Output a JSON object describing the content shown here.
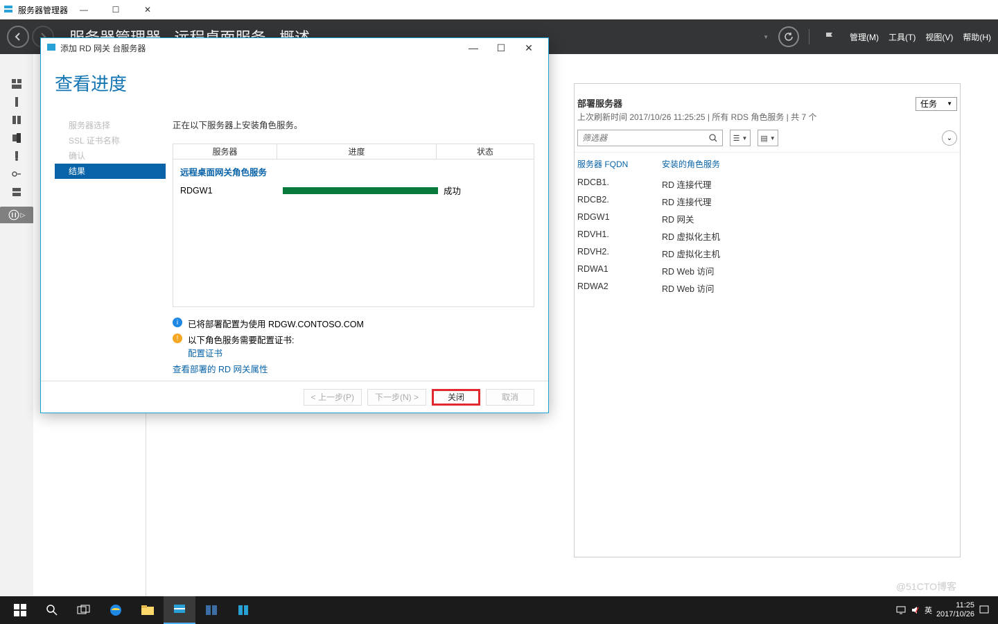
{
  "app": {
    "title": "服务器管理器",
    "breadcrumb": "服务器管理器 · 远程桌面服务 · 概述",
    "menu": {
      "manage": "管理(M)",
      "tools": "工具(T)",
      "view": "视图(V)",
      "help": "帮助(H)"
    }
  },
  "deploy": {
    "title": "部署服务器",
    "sub": "上次刷新时间 2017/10/26 11:25:25 | 所有 RDS 角色服务  | 共 7 个",
    "task_btn": "任务",
    "filter_placeholder": "筛选器",
    "headers": {
      "fqdn": "服务器 FQDN",
      "role": "安装的角色服务"
    },
    "rows": [
      {
        "fqdn": "RDCB1.",
        "role": "RD 连接代理"
      },
      {
        "fqdn": "RDCB2.",
        "role": "RD 连接代理"
      },
      {
        "fqdn": "RDGW1",
        "role": "RD 网关"
      },
      {
        "fqdn": "RDVH1.",
        "role": "RD 虚拟化主机"
      },
      {
        "fqdn": "RDVH2.",
        "role": "RD 虚拟化主机"
      },
      {
        "fqdn": "RDWA1",
        "role": "RD Web 访问"
      },
      {
        "fqdn": "RDWA2",
        "role": "RD Web 访问"
      }
    ]
  },
  "wizard": {
    "window_title": "添加 RD 网关 台服务器",
    "heading": "查看进度",
    "nav": {
      "server_select": "服务器选择",
      "ssl": "SSL 证书名称",
      "confirm": "确认",
      "result": "结果"
    },
    "desc": "正在以下服务器上安装角色服务。",
    "table": {
      "headers": {
        "server": "服务器",
        "progress": "进度",
        "status": "状态"
      },
      "section": "远程桌面网关角色服务",
      "row": {
        "server": "RDGW1",
        "status": "成功",
        "progress_pct": 100
      }
    },
    "notes": {
      "info": "已将部署配置为使用 RDGW.CONTOSO.COM",
      "warn": "以下角色服务需要配置证书:",
      "cert_link": "配置证书",
      "link": "查看部署的 RD 网关属性"
    },
    "buttons": {
      "prev": "< 上一步(P)",
      "next": "下一步(N) >",
      "close": "关闭",
      "cancel": "取消"
    }
  },
  "taskbar": {
    "ime": "英",
    "time": "11:25",
    "date": "2017/10/26"
  },
  "watermark": "@51CTO博客"
}
